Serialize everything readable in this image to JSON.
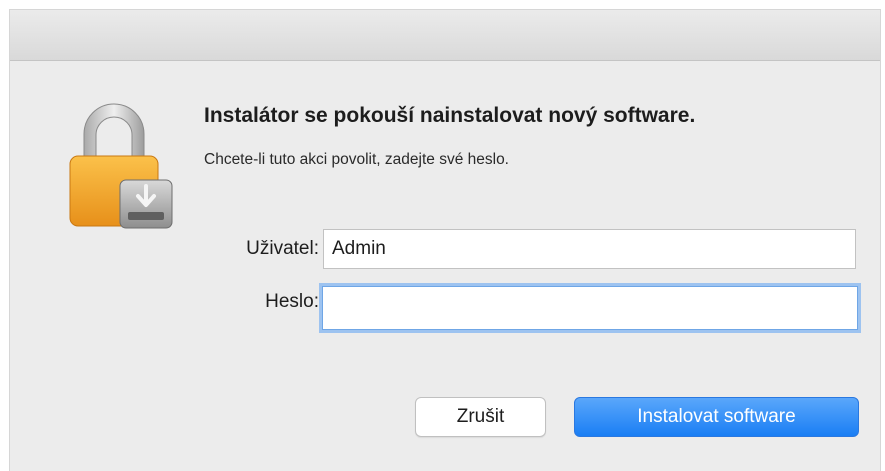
{
  "dialog": {
    "title": "Instalátor se pokouší nainstalovat nový software.",
    "subtitle": "Chcete-li tuto akci povolit, zadejte své heslo."
  },
  "form": {
    "username_label": "Uživatel:",
    "username_value": "Admin",
    "password_label": "Heslo:",
    "password_value": ""
  },
  "buttons": {
    "cancel_label": "Zrušit",
    "install_label": "Instalovat software"
  },
  "icons": {
    "lock": "lock-installer-icon"
  },
  "colors": {
    "accent": "#1a7ef4",
    "lock_body": "#f6a623",
    "focus_ring": "#9dc3f0"
  }
}
